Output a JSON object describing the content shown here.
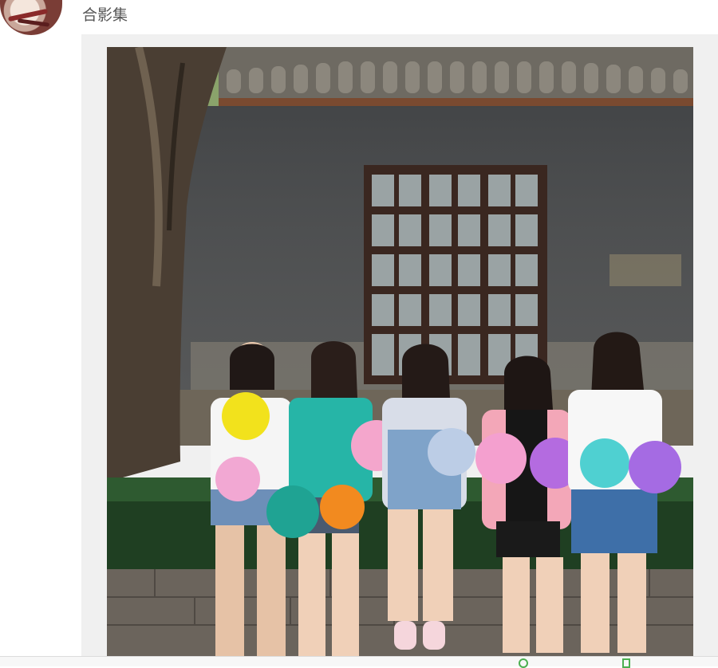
{
  "post": {
    "author_name": "合影集",
    "photo_icon": "group-photo-image"
  },
  "bottom_bar": {
    "left_icon": "circle-icon",
    "right_icon": "square-icon"
  }
}
